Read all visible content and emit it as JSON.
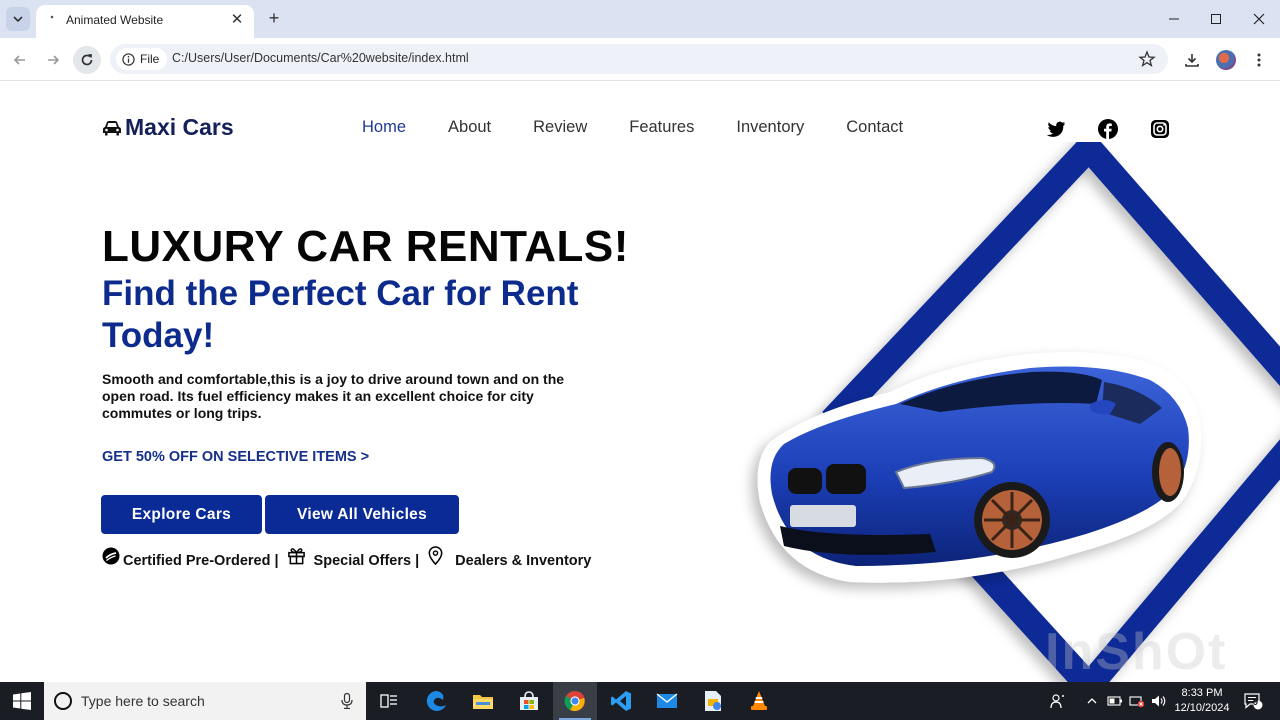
{
  "browser": {
    "tab_title": "Animated Website",
    "site_chip": "File",
    "url": "C:/Users/User/Documents/Car%20website/index.html"
  },
  "site": {
    "logo_text": "Maxi Cars",
    "nav": [
      "Home",
      "About",
      "Review",
      "Features",
      "Inventory",
      "Contact"
    ],
    "active_nav": "Home",
    "social_icons": [
      "twitter-icon",
      "facebook-icon",
      "instagram-icon"
    ]
  },
  "hero": {
    "headline": "LUXURY CAR RENTALS!",
    "subheadline": "Find the Perfect Car for Rent Today!",
    "description": "Smooth and comfortable,this is a joy to drive around town and on the open road. Its fuel efficiency makes it an excellent choice for city commutes or long trips.",
    "promo_link": "GET 50% OFF ON SELECTIVE ITEMS >",
    "buttons": {
      "explore": "Explore Cars",
      "view_all": "View All Vehicles"
    },
    "features": [
      "Certified Pre-Ordered |",
      "Special Offers |",
      "Dealers & Inventory"
    ]
  },
  "colors": {
    "brand_blue": "#0a2a96",
    "heading_blue": "#0d2b8c",
    "logo_navy": "#15205a"
  },
  "taskbar": {
    "search_placeholder": "Type here to search",
    "time": "8:33 PM",
    "date": "12/10/2024",
    "notification_count": "9",
    "apps": [
      "task-view-icon",
      "edge-icon",
      "file-explorer-icon",
      "store-icon",
      "chrome-icon",
      "vscode-icon",
      "mail-icon",
      "app-icon",
      "vlc-icon"
    ]
  }
}
